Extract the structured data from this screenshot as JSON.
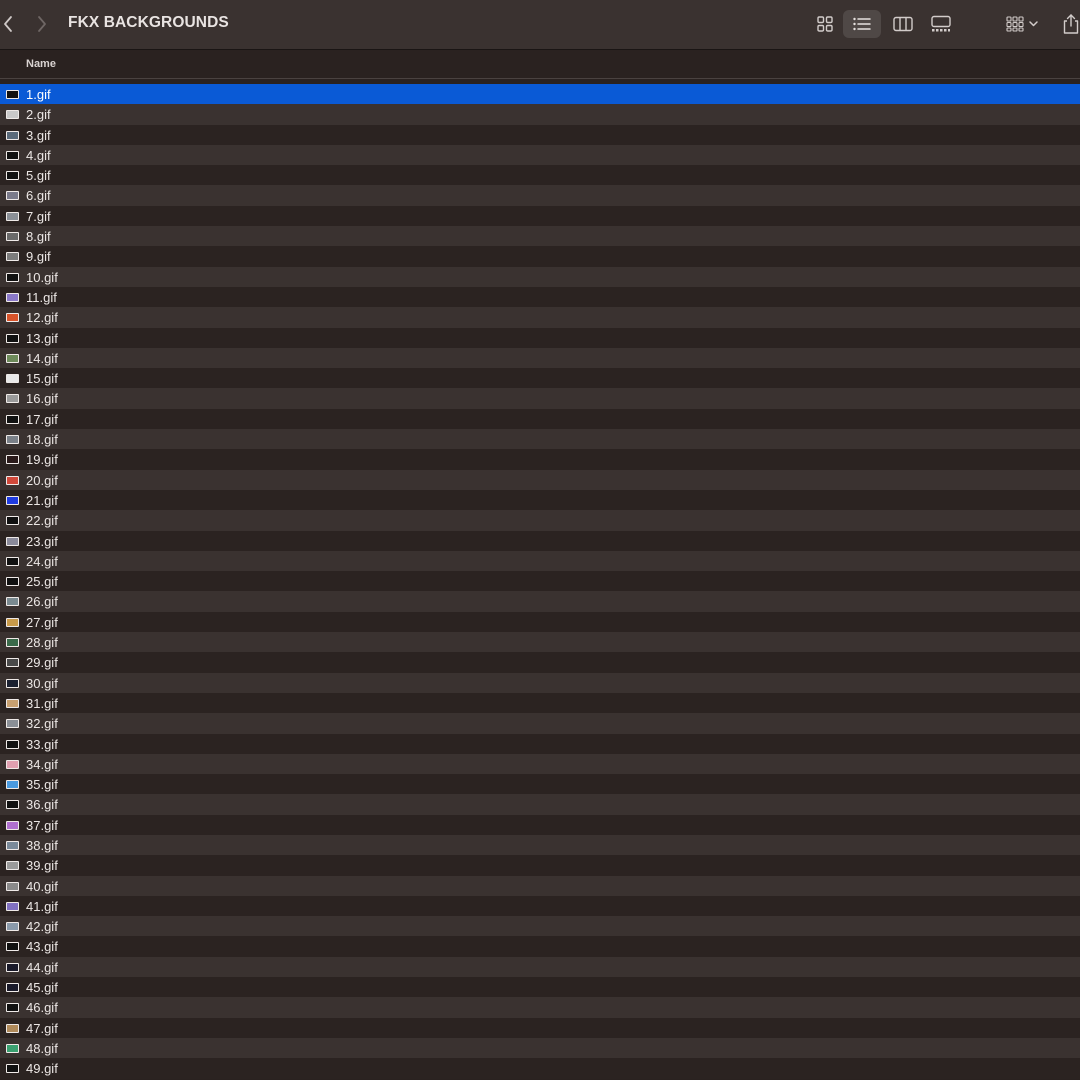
{
  "window": {
    "title": "FKX BACKGROUNDS"
  },
  "toolbar": {
    "back_icon": "chevron-left-icon",
    "forward_icon": "chevron-right-icon",
    "view_icon_grid": "grid-icon",
    "view_list": "list-icon",
    "view_columns": "columns-icon",
    "view_gallery": "gallery-icon",
    "group_icon": "group-icon",
    "share_icon": "share-icon",
    "active_view": "list"
  },
  "columns": {
    "name": "Name"
  },
  "colors": {
    "selection": "#0a5ad6",
    "row_even": "#2b2321",
    "row_odd": "#3a3230"
  },
  "files": [
    {
      "name": "1.gif",
      "thumb": "#111111"
    },
    {
      "name": "2.gif",
      "thumb": "#c9c9c9"
    },
    {
      "name": "3.gif",
      "thumb": "#5a6a7a"
    },
    {
      "name": "4.gif",
      "thumb": "#111111"
    },
    {
      "name": "5.gif",
      "thumb": "#111111"
    },
    {
      "name": "6.gif",
      "thumb": "#7a7a8a"
    },
    {
      "name": "7.gif",
      "thumb": "#8a8f96"
    },
    {
      "name": "8.gif",
      "thumb": "#6a6a6a"
    },
    {
      "name": "9.gif",
      "thumb": "#7c7c7c"
    },
    {
      "name": "10.gif",
      "thumb": "#111111"
    },
    {
      "name": "11.gif",
      "thumb": "#8a78c8"
    },
    {
      "name": "12.gif",
      "thumb": "#d8532a"
    },
    {
      "name": "13.gif",
      "thumb": "#111111"
    },
    {
      "name": "14.gif",
      "thumb": "#6d8a5a"
    },
    {
      "name": "15.gif",
      "thumb": "#e8e8e8"
    },
    {
      "name": "16.gif",
      "thumb": "#9a9a9a"
    },
    {
      "name": "17.gif",
      "thumb": "#111111"
    },
    {
      "name": "18.gif",
      "thumb": "#7a8088"
    },
    {
      "name": "19.gif",
      "thumb": "#2a1a1a"
    },
    {
      "name": "20.gif",
      "thumb": "#d0483a"
    },
    {
      "name": "21.gif",
      "thumb": "#1f3be0"
    },
    {
      "name": "22.gif",
      "thumb": "#111111"
    },
    {
      "name": "23.gif",
      "thumb": "#8a8a9a"
    },
    {
      "name": "24.gif",
      "thumb": "#111111"
    },
    {
      "name": "25.gif",
      "thumb": "#111111"
    },
    {
      "name": "26.gif",
      "thumb": "#7a8a90"
    },
    {
      "name": "27.gif",
      "thumb": "#c89a4a"
    },
    {
      "name": "28.gif",
      "thumb": "#3a6a4a"
    },
    {
      "name": "29.gif",
      "thumb": "#4a4a4a"
    },
    {
      "name": "30.gif",
      "thumb": "#1a2030"
    },
    {
      "name": "31.gif",
      "thumb": "#c8a070"
    },
    {
      "name": "32.gif",
      "thumb": "#8a8f96"
    },
    {
      "name": "33.gif",
      "thumb": "#111111"
    },
    {
      "name": "34.gif",
      "thumb": "#e0a0b0"
    },
    {
      "name": "35.gif",
      "thumb": "#4a9ae0"
    },
    {
      "name": "36.gif",
      "thumb": "#111111"
    },
    {
      "name": "37.gif",
      "thumb": "#b070d0"
    },
    {
      "name": "38.gif",
      "thumb": "#7a8a9a"
    },
    {
      "name": "39.gif",
      "thumb": "#9a9a9a"
    },
    {
      "name": "40.gif",
      "thumb": "#8a8a8a"
    },
    {
      "name": "41.gif",
      "thumb": "#8070c0"
    },
    {
      "name": "42.gif",
      "thumb": "#8a9aaa"
    },
    {
      "name": "43.gif",
      "thumb": "#111111"
    },
    {
      "name": "44.gif",
      "thumb": "#1a1a2a"
    },
    {
      "name": "45.gif",
      "thumb": "#1a1a2a"
    },
    {
      "name": "46.gif",
      "thumb": "#111111"
    },
    {
      "name": "47.gif",
      "thumb": "#b08a5a"
    },
    {
      "name": "48.gif",
      "thumb": "#3aa070"
    },
    {
      "name": "49.gif",
      "thumb": "#111111"
    }
  ],
  "selected_file": "1.gif"
}
